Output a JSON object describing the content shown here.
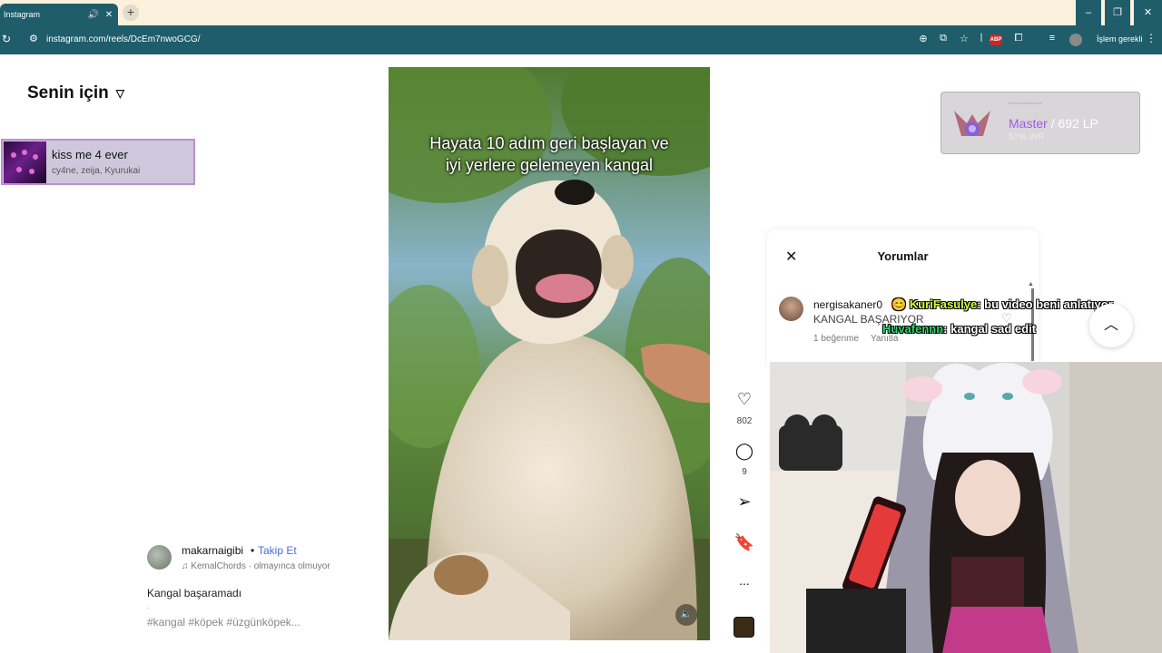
{
  "browser": {
    "tab_title": "Instagram",
    "url": "instagram.com/reels/DcEm7nwoGCG/",
    "action_label": "İşlem gerekli"
  },
  "sidebar": {
    "section_title": "Senin için"
  },
  "now_playing": {
    "title": "kiss me 4 ever",
    "artists": "cy4ne, zeija, Kyurukai"
  },
  "reel": {
    "overlay_text_line1": "Hayata 10 adım geri başlayan ve",
    "overlay_text_line2": "iyi yerlere gelemeyen kangal",
    "author": "makarnaigibi",
    "separator": "•",
    "follow_label": "Takip Et",
    "audio": "KemalChords · olmayınca olmuyor",
    "caption": "Kangal başaramadı",
    "caption_more": ".",
    "hashtags": "#kangal #köpek #üzgünköpek..."
  },
  "actions": {
    "like_count": "802",
    "comment_count": "9",
    "more": "..."
  },
  "rank_overlay": {
    "tier": "Master",
    "separator": "/",
    "lp": "692 LP",
    "sub": "57% WR"
  },
  "comments": {
    "title": "Yorumlar",
    "items": [
      {
        "user": "nergisakaner0",
        "text": "KANGAL BAŞARIYOR",
        "likes": "1 beğenme",
        "reply": "Yanıtla"
      }
    ]
  },
  "chat": {
    "messages": [
      {
        "name": "KuriFasulye",
        "text": ": bu video beni anlatıyor"
      },
      {
        "name": "Huvafennn",
        "text": ": kangal sad edit"
      }
    ]
  },
  "colors": {
    "browser_chrome": "#1f5d6b",
    "follow_link": "#4a6fd6",
    "rank_tier": "#9a5fe0",
    "chat_name_1": "#d4ff3a",
    "chat_name_2": "#29d86b"
  }
}
